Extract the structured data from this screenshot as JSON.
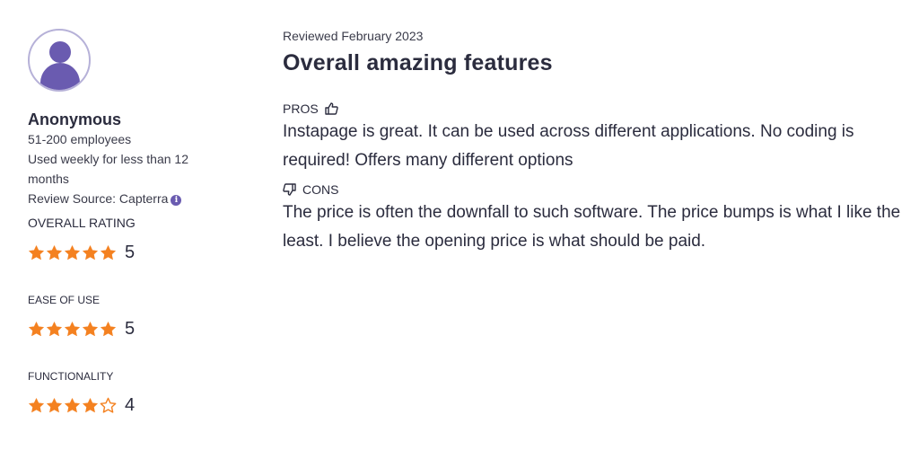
{
  "reviewer": {
    "name": "Anonymous",
    "company_size": "51-200 employees",
    "usage": "Used weekly for less than 12 months",
    "source": "Review Source: Capterra",
    "avatar_color": "#6a5bb0"
  },
  "ratings": [
    {
      "label": "OVERALL RATING",
      "value": "5",
      "stars": 5
    },
    {
      "label": "EASE OF USE",
      "value": "5",
      "stars": 5
    },
    {
      "label": "FUNCTIONALITY",
      "value": "4",
      "stars": 4
    }
  ],
  "star_color": "#f48120",
  "review": {
    "date": "Reviewed February 2023",
    "title": "Overall amazing features",
    "pros_label": "PROS",
    "pros_text": "Instapage is great. It can be used across different applications. No coding is required! Offers many different options",
    "cons_label": "CONS",
    "cons_text": "The price is often the downfall to such software. The price bumps is what I like the least. I believe the opening price is what should be paid."
  }
}
